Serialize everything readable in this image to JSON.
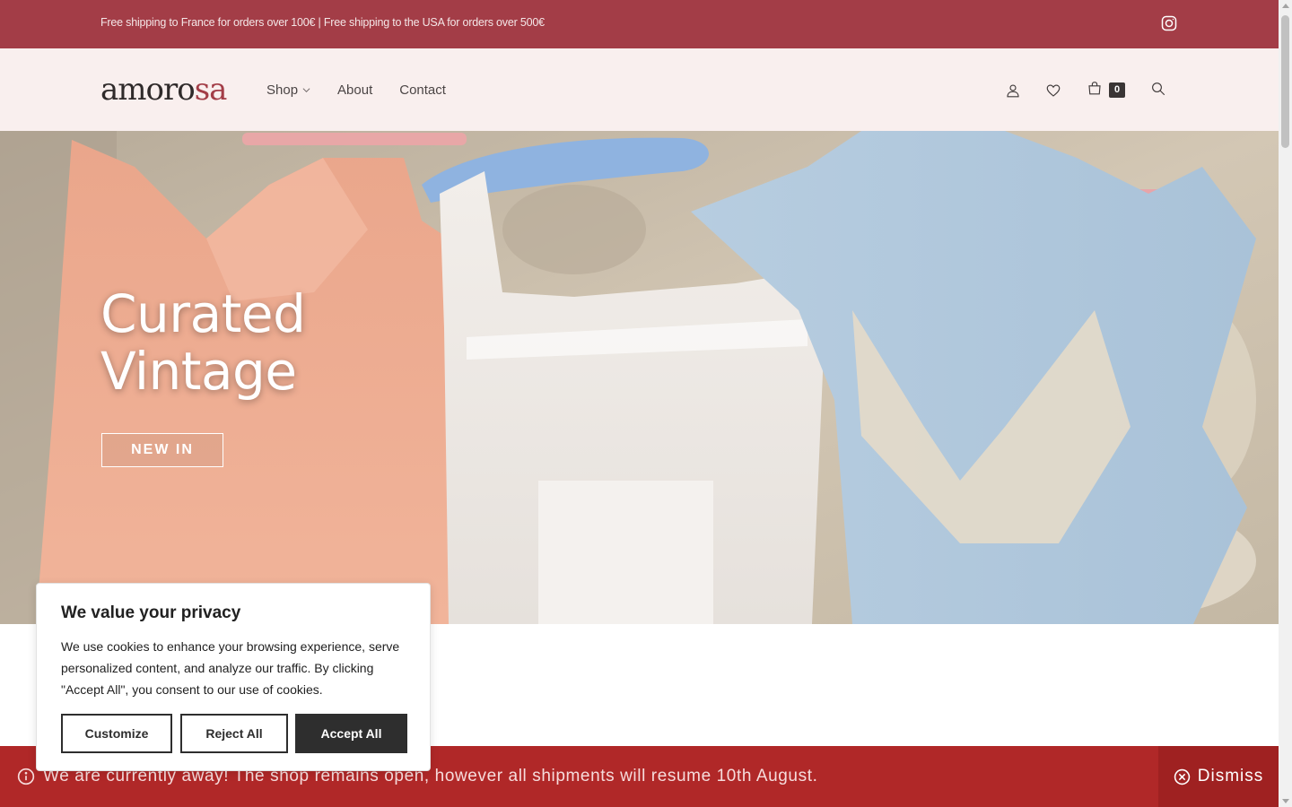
{
  "topbar": {
    "promo": "Free shipping to France for orders over 100€ | Free shipping to the USA for orders over 500€",
    "instagram_icon": "instagram-icon"
  },
  "header": {
    "logo_main": "amoro",
    "logo_accent": "sa",
    "nav": [
      {
        "label": "Shop",
        "has_dropdown": true
      },
      {
        "label": "About"
      },
      {
        "label": "Contact"
      }
    ],
    "icons": [
      "user-icon",
      "heart-icon",
      "cart-icon",
      "search-icon"
    ],
    "cart_count": "0"
  },
  "hero": {
    "title_line1": "Curated",
    "title_line2": "Vintage",
    "cta": "NEW IN"
  },
  "cookie": {
    "title": "We value your privacy",
    "body": "We use cookies to enhance your browsing experience, serve personalized content, and analyze our traffic. By clicking \"Accept All\", you consent to our use of cookies.",
    "customize": "Customize",
    "reject": "Reject All",
    "accept": "Accept All"
  },
  "announcement": {
    "message": "We are currently away! The shop remains open, however all shipments will resume 10th August.",
    "dismiss": "Dismiss"
  },
  "colors": {
    "topbar": "#a33d47",
    "header_bg": "#f9efee",
    "announce_bg": "#b02828",
    "dismiss_bg": "#9f2121",
    "dark_button": "#2e2e2e"
  }
}
